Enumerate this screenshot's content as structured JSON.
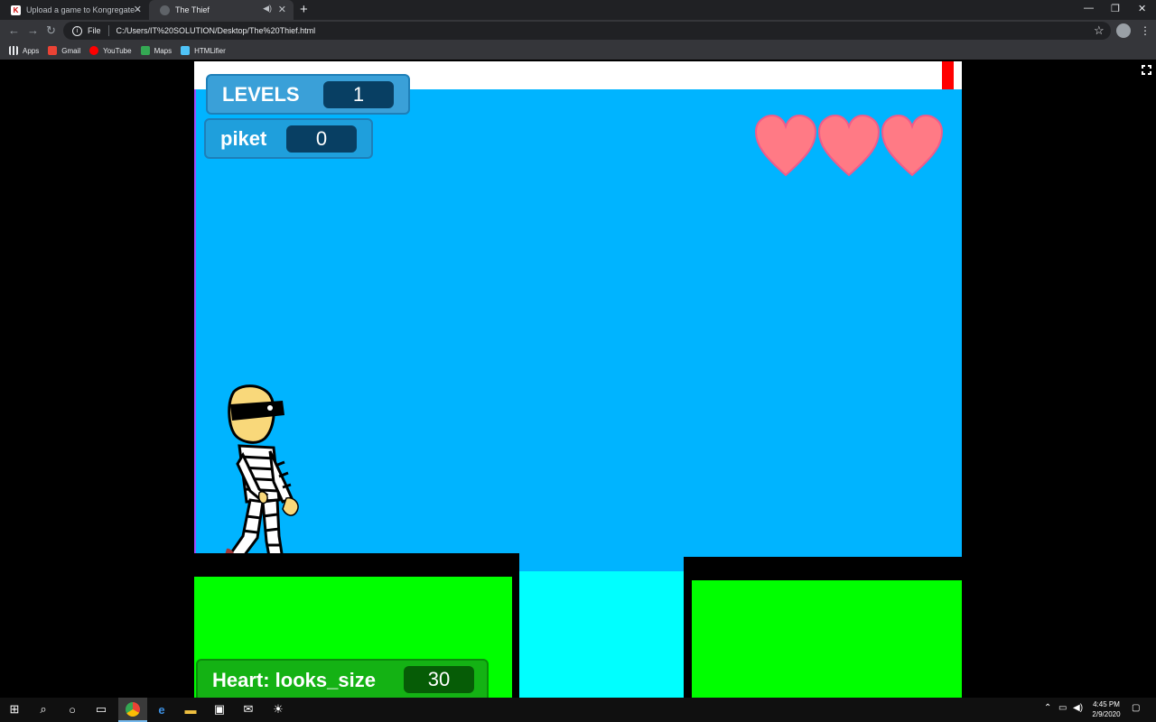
{
  "browser": {
    "tabs": [
      {
        "title": "Upload a game to Kongregate -",
        "favicon": "kongregate-icon"
      },
      {
        "title": "The Thief",
        "favicon": "globe-icon",
        "audio": true
      }
    ],
    "url_scheme": "File",
    "url": "C:/Users/IT%20SOLUTION/Desktop/The%20Thief.html",
    "bookmarks": [
      {
        "label": "Apps",
        "icon": "apps-grid-icon",
        "color": "#e8eaed"
      },
      {
        "label": "Gmail",
        "icon": "gmail-icon",
        "color": "#ea4335"
      },
      {
        "label": "YouTube",
        "icon": "youtube-icon",
        "color": "#ff0000"
      },
      {
        "label": "Maps",
        "icon": "maps-icon",
        "color": "#34a853"
      },
      {
        "label": "HTMLifier",
        "icon": "htmlifier-icon",
        "color": "#4fc3f7"
      }
    ]
  },
  "game": {
    "levels_label": "LEVELS",
    "levels_value": "1",
    "score_label": "piket",
    "score_value": "0",
    "lives": 3,
    "heart_monitor_label": "Heart: looks_size",
    "heart_monitor_value": "30",
    "colors": {
      "sky": "#00b4ff",
      "ground": "#00ff00",
      "water": "#00ffff",
      "heart": "#ff7a85"
    }
  },
  "taskbar": {
    "time": "4:45 PM",
    "date": "2/9/2020"
  }
}
